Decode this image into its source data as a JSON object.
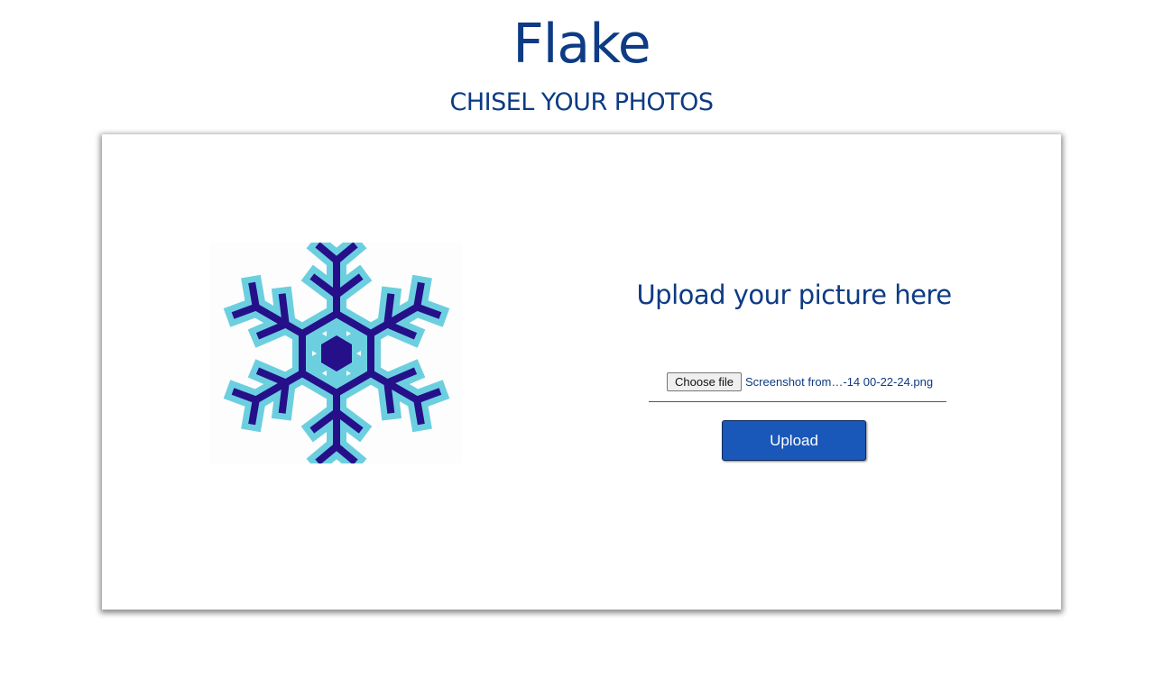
{
  "header": {
    "title": "Flake",
    "subtitle": "CHISEL YOUR PHOTOS"
  },
  "upload_panel": {
    "heading": "Upload your picture here",
    "choose_file_label": "Choose file",
    "selected_file_name": "Screenshot from…-14 00-22-24.png",
    "upload_label": "Upload"
  },
  "logo": {
    "icon": "snowflake-icon",
    "outer_color": "#6ccfe0",
    "inner_color": "#25108a"
  },
  "colors": {
    "brand": "#0d3b84",
    "button": "#1957b8"
  }
}
